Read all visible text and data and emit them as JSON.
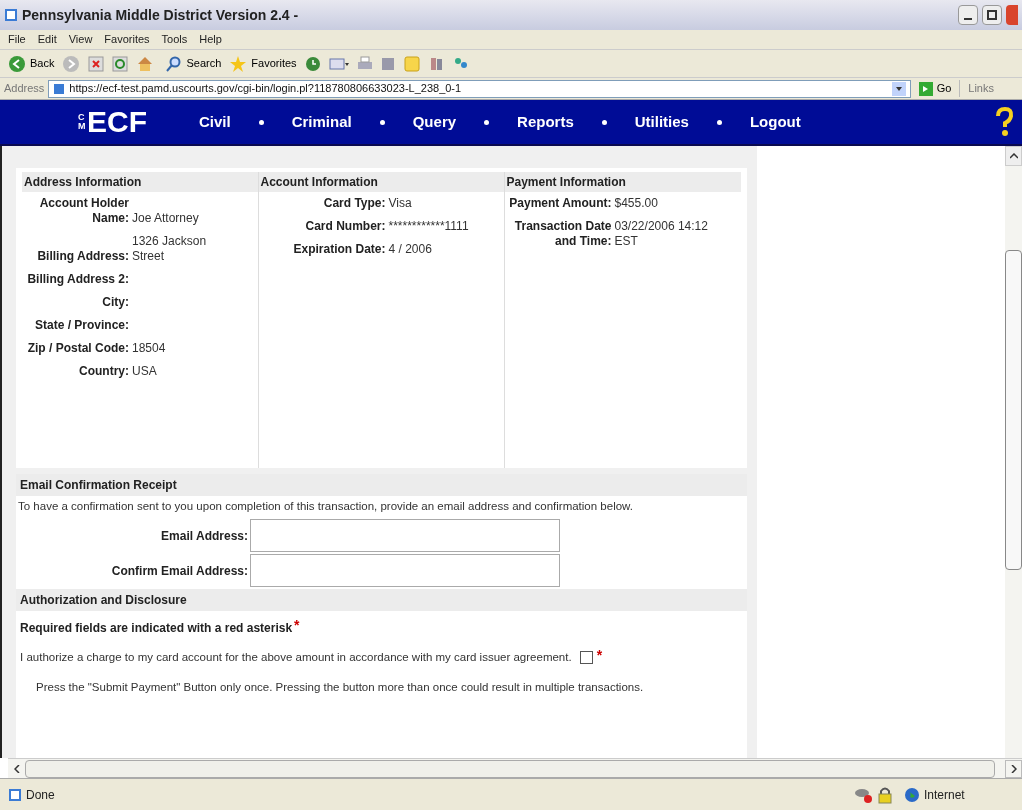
{
  "window": {
    "title": "Pennsylvania Middle District Version 2.4 -"
  },
  "menu_bar": [
    "File",
    "Edit",
    "View",
    "Favorites",
    "Tools",
    "Help"
  ],
  "toolbar": {
    "back": "Back",
    "search": "Search",
    "favorites": "Favorites"
  },
  "address_bar": {
    "label": "Address",
    "url": "https://ecf-test.pamd.uscourts.gov/cgi-bin/login.pl?118780806633023-L_238_0-1",
    "go": "Go",
    "links": "Links"
  },
  "nav": {
    "logo_small": "CM",
    "logo": "ECF",
    "items": [
      "Civil",
      "Criminal",
      "Query",
      "Reports",
      "Utilities",
      "Logout"
    ]
  },
  "info_sections": [
    {
      "title": "Address Information",
      "fields": [
        {
          "label": "Account Holder Name:",
          "value": "Joe Attorney"
        },
        {
          "label": "Billing Address:",
          "value": "1326 Jackson Street"
        },
        {
          "label": "Billing Address 2:"
        },
        {
          "label": "City:"
        },
        {
          "label": "State / Province:"
        },
        {
          "label": "Zip / Postal Code:",
          "value": "18504"
        },
        {
          "label": "Country:",
          "value": "USA"
        }
      ]
    },
    {
      "title": "Account Information",
      "fields": [
        {
          "label": "Card Type:",
          "value": "Visa"
        },
        {
          "label": "Card Number:",
          "value": "************1111"
        },
        {
          "label": "Expiration Date:",
          "value": "4 / 2006"
        }
      ]
    },
    {
      "title": "Payment Information",
      "fields": [
        {
          "label": "Payment Amount:",
          "value": "$455.00"
        },
        {
          "label": "Transaction Date and Time:",
          "value": "03/22/2006 14:12 EST"
        }
      ]
    }
  ],
  "email_section": {
    "title": "Email Confirmation Receipt",
    "instruction": "To have a confirmation sent to you upon completion of this transaction, provide an email address and confirmation below.",
    "fields": [
      {
        "label": "Email Address:"
      },
      {
        "label": "Confirm Email Address:"
      }
    ]
  },
  "authorization": {
    "title": "Authorization and Disclosure",
    "required_note": "Required fields are indicated with a red asterisk",
    "required_mark": "*",
    "agreement": {
      "text": "I authorize a charge to my card account for the above amount in accordance with my card issuer agreement.",
      "checked": false,
      "required_mark": "*"
    },
    "warning": "Press the \"Submit Payment\" Button only once. Pressing the button more than once could result in multiple transactions."
  },
  "status_bar": {
    "status": "Done",
    "zone": "Internet"
  }
}
